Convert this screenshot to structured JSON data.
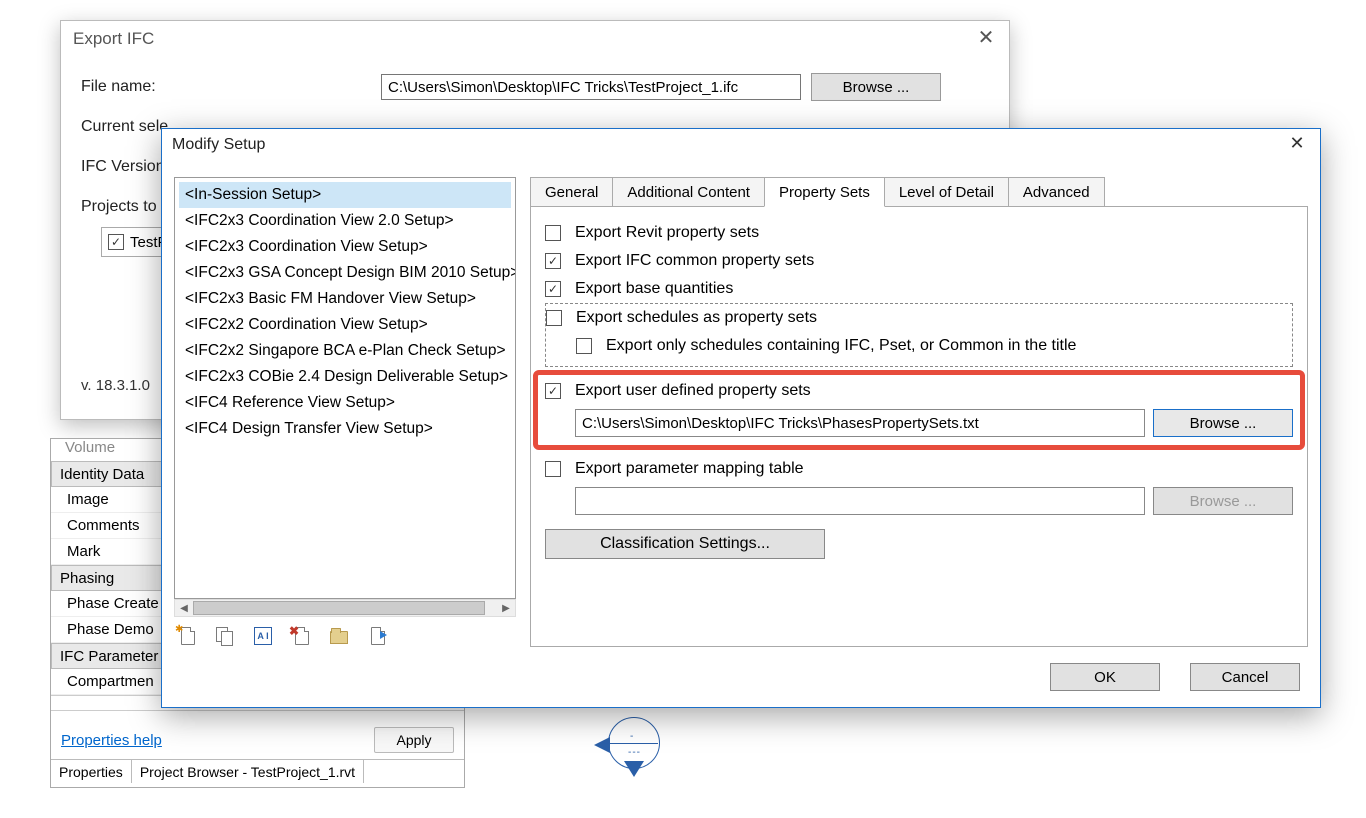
{
  "exportWindow": {
    "title": "Export IFC",
    "fileNameLabel": "File name:",
    "fileNameValue": "C:\\Users\\Simon\\Desktop\\IFC Tricks\\TestProject_1.ifc",
    "browse": "Browse ...",
    "currentSelectedLabel": "Current sele",
    "ifcVersionLabel": "IFC Version",
    "projectsLabel": "Projects to",
    "projectItemLabel": "TestPro",
    "version": "v. 18.3.1.0"
  },
  "propsPanel": {
    "volumeLabel": "Volume",
    "sections": {
      "identity": "Identity Data",
      "identityItems": [
        "Image",
        "Comments",
        "Mark"
      ],
      "phasing": "Phasing",
      "phasingItems": [
        "Phase Create",
        "Phase Demo"
      ],
      "ifcParams": "IFC Parameter",
      "ifcParamsItems": [
        "Compartmen"
      ]
    },
    "helpLink": "Properties help",
    "applyBtn": "Apply",
    "bottomTabs": [
      "Properties",
      "Project Browser - TestProject_1.rvt"
    ]
  },
  "modifyDialog": {
    "title": "Modify Setup",
    "setupList": [
      "<In-Session Setup>",
      "<IFC2x3 Coordination View 2.0 Setup>",
      "<IFC2x3 Coordination View Setup>",
      "<IFC2x3 GSA Concept Design BIM 2010 Setup>",
      "<IFC2x3 Basic FM Handover View Setup>",
      "<IFC2x2 Coordination View Setup>",
      "<IFC2x2 Singapore BCA e-Plan Check Setup>",
      "<IFC2x3 COBie 2.4 Design Deliverable Setup>",
      "<IFC4 Reference View Setup>",
      "<IFC4 Design Transfer View Setup>"
    ],
    "tabs": [
      "General",
      "Additional Content",
      "Property Sets",
      "Level of Detail",
      "Advanced"
    ],
    "activeTabIndex": 2,
    "options": {
      "revit": {
        "label": "Export Revit property sets",
        "checked": false
      },
      "common": {
        "label": "Export IFC common property sets",
        "checked": true
      },
      "baseQ": {
        "label": "Export base quantities",
        "checked": true
      },
      "schedules": {
        "label": "Export schedules as property sets",
        "checked": false
      },
      "schedulesSub": {
        "label": "Export only schedules containing IFC, Pset, or Common in the title",
        "checked": false
      },
      "userDefined": {
        "label": "Export user defined property sets",
        "checked": true
      },
      "userPath": "C:\\Users\\Simon\\Desktop\\IFC Tricks\\PhasesPropertySets.txt",
      "mapping": {
        "label": "Export parameter mapping table",
        "checked": false
      },
      "mappingPath": ""
    },
    "browseBtn": "Browse ...",
    "classifBtn": "Classification Settings...",
    "okBtn": "OK",
    "cancelBtn": "Cancel"
  }
}
